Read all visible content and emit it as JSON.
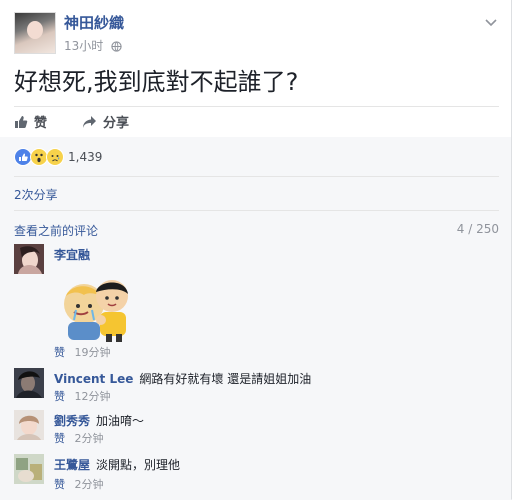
{
  "post": {
    "author": "神田紗織",
    "time": "13小时",
    "text": "好想死,我到底對不起誰了?",
    "actions": {
      "like": "赞",
      "share": "分享"
    },
    "reaction_count": "1,439",
    "shares": "2次分享"
  },
  "comments_header": {
    "view_previous": "查看之前的评论",
    "count": "4 / 250"
  },
  "comments": [
    {
      "name": "李宜融",
      "text": "",
      "like": "赞",
      "time": "19分钟"
    },
    {
      "name": "Vincent Lee",
      "text": "網路有好就有壞 還是請姐姐加油",
      "like": "赞",
      "time": "12分钟"
    },
    {
      "name": "劉秀秀",
      "text": "加油唷～",
      "like": "赞",
      "time": "2分钟"
    },
    {
      "name": "王鷺屋",
      "text": "淡開點，別理他",
      "like": "赞",
      "time": "2分钟"
    }
  ],
  "colors": {
    "link": "#365899",
    "meta": "#90949c",
    "like_reaction": "#4e82e8"
  },
  "icons": [
    "caret-down-icon",
    "globe-icon",
    "like-icon",
    "share-icon",
    "wow-icon",
    "sad-icon"
  ]
}
